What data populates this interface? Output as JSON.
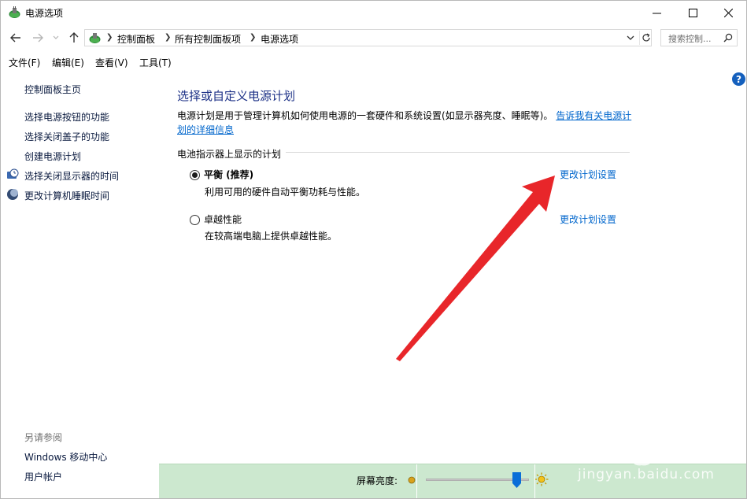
{
  "window": {
    "title": "电源选项"
  },
  "address": {
    "crumbs": [
      "控制面板",
      "所有控制面板项",
      "电源选项"
    ],
    "search_placeholder": "搜索控制..."
  },
  "menu": {
    "items": [
      "文件(F)",
      "编辑(E)",
      "查看(V)",
      "工具(T)"
    ]
  },
  "sidebar": {
    "home": "控制面板主页",
    "links": [
      "选择电源按钮的功能",
      "选择关闭盖子的功能",
      "创建电源计划",
      "选择关闭显示器的时间",
      "更改计算机睡眠时间"
    ],
    "see_also_label": "另请参阅",
    "see_also": [
      "Windows 移动中心",
      "用户帐户"
    ]
  },
  "main": {
    "title": "选择或自定义电源计划",
    "description": "电源计划是用于管理计算机如何使用电源的一套硬件和系统设置(如显示器亮度、睡眠等)。",
    "description_link": "告诉我有关电源计划的详细信息",
    "group_label": "电池指示器上显示的计划",
    "plans": [
      {
        "name": "平衡 (推荐)",
        "desc": "利用可用的硬件自动平衡功耗与性能。",
        "link": "更改计划设置",
        "selected": true
      },
      {
        "name": "卓越性能",
        "desc": "在较高端电脑上提供卓越性能。",
        "link": "更改计划设置",
        "selected": false
      }
    ],
    "help_glyph": "?"
  },
  "brightness": {
    "label": "屏幕亮度:",
    "level_percent": 92
  },
  "watermark": {
    "text": "jingyan.baidu.com"
  },
  "colors": {
    "link": "#0066cc",
    "title": "#1e3287",
    "brightness_bar": "#cce8cf",
    "annotation_arrow": "#e8262a"
  }
}
